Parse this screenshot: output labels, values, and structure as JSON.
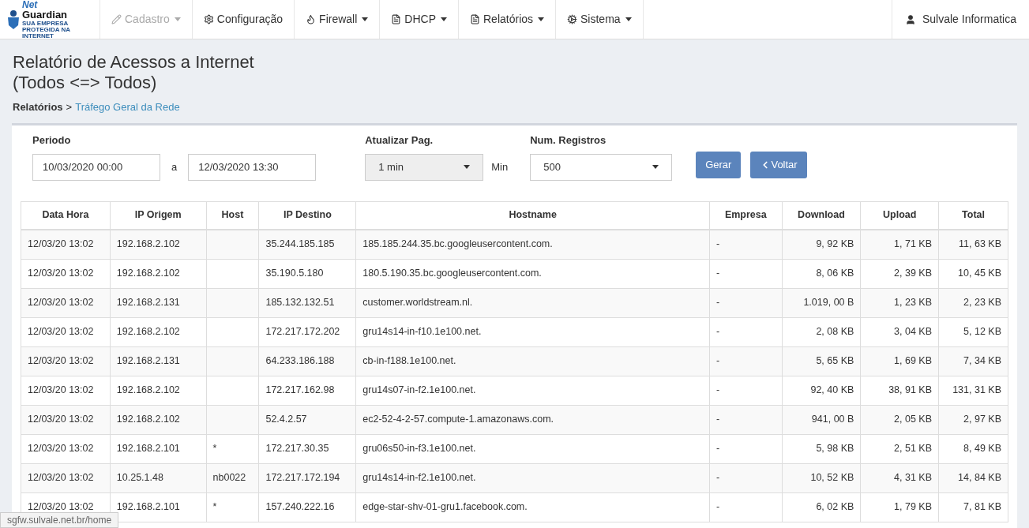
{
  "logo": {
    "line1": "Net",
    "line2": "Guardian",
    "tagline": "SUA EMPRESA PROTEGIDA NA INTERNET"
  },
  "nav": [
    {
      "label": "Cadastro",
      "dropdown": true,
      "disabled": true
    },
    {
      "label": "Configuração",
      "dropdown": false,
      "disabled": false
    },
    {
      "label": "Firewall",
      "dropdown": true,
      "disabled": false
    },
    {
      "label": "DHCP",
      "dropdown": true,
      "disabled": false
    },
    {
      "label": "Relatórios",
      "dropdown": true,
      "disabled": false
    },
    {
      "label": "Sistema",
      "dropdown": true,
      "disabled": false
    }
  ],
  "user": "Sulvale Informatica",
  "title_line1": "Relatório de Acessos a Internet",
  "title_line2": "(Todos <=> Todos)",
  "breadcrumb": {
    "parent": "Relatórios",
    "separator": ">",
    "current": "Tráfego Geral da Rede"
  },
  "form": {
    "period_label": "Periodo",
    "date_from": "10/03/2020 00:00",
    "between": "a",
    "date_to": "12/03/2020 13:30",
    "refresh_label": "Atualizar Pag.",
    "refresh_value": "1 min",
    "refresh_unit": "Min",
    "count_label": "Num. Registros",
    "count_value": "500",
    "generate_button": "Gerar",
    "back_button": "Voltar"
  },
  "table": {
    "columns": [
      "Data Hora",
      "IP Origem",
      "Host",
      "IP Destino",
      "Hostname",
      "Empresa",
      "Download",
      "Upload",
      "Total"
    ],
    "rows": [
      [
        "12/03/20 13:02",
        "192.168.2.102",
        "",
        "35.244.185.185",
        "185.185.244.35.bc.googleusercontent.com.",
        "-",
        "9, 92 KB",
        "1, 71 KB",
        "11, 63 KB"
      ],
      [
        "12/03/20 13:02",
        "192.168.2.102",
        "",
        "35.190.5.180",
        "180.5.190.35.bc.googleusercontent.com.",
        "-",
        "8, 06 KB",
        "2, 39 KB",
        "10, 45 KB"
      ],
      [
        "12/03/20 13:02",
        "192.168.2.131",
        "",
        "185.132.132.51",
        "customer.worldstream.nl.",
        "-",
        "1.019, 00 B",
        "1, 23 KB",
        "2, 23 KB"
      ],
      [
        "12/03/20 13:02",
        "192.168.2.102",
        "",
        "172.217.172.202",
        "gru14s14-in-f10.1e100.net.",
        "-",
        "2, 08 KB",
        "3, 04 KB",
        "5, 12 KB"
      ],
      [
        "12/03/20 13:02",
        "192.168.2.131",
        "",
        "64.233.186.188",
        "cb-in-f188.1e100.net.",
        "-",
        "5, 65 KB",
        "1, 69 KB",
        "7, 34 KB"
      ],
      [
        "12/03/20 13:02",
        "192.168.2.102",
        "",
        "172.217.162.98",
        "gru14s07-in-f2.1e100.net.",
        "-",
        "92, 40 KB",
        "38, 91 KB",
        "131, 31 KB"
      ],
      [
        "12/03/20 13:02",
        "192.168.2.102",
        "",
        "52.4.2.57",
        "ec2-52-4-2-57.compute-1.amazonaws.com.",
        "-",
        "941, 00 B",
        "2, 05 KB",
        "2, 97 KB"
      ],
      [
        "12/03/20 13:02",
        "192.168.2.101",
        "*",
        "172.217.30.35",
        "gru06s50-in-f3.1e100.net.",
        "-",
        "5, 98 KB",
        "2, 51 KB",
        "8, 49 KB"
      ],
      [
        "12/03/20 13:02",
        "10.25.1.48",
        "nb0022",
        "172.217.172.194",
        "gru14s14-in-f2.1e100.net.",
        "-",
        "10, 52 KB",
        "4, 31 KB",
        "14, 84 KB"
      ],
      [
        "12/03/20 13:02",
        "192.168.2.101",
        "*",
        "157.240.222.16",
        "edge-star-shv-01-gru1.facebook.com.",
        "-",
        "6, 02 KB",
        "1, 79 KB",
        "7, 81 KB"
      ]
    ]
  },
  "status_url": "sgfw.sulvale.net.br/home"
}
